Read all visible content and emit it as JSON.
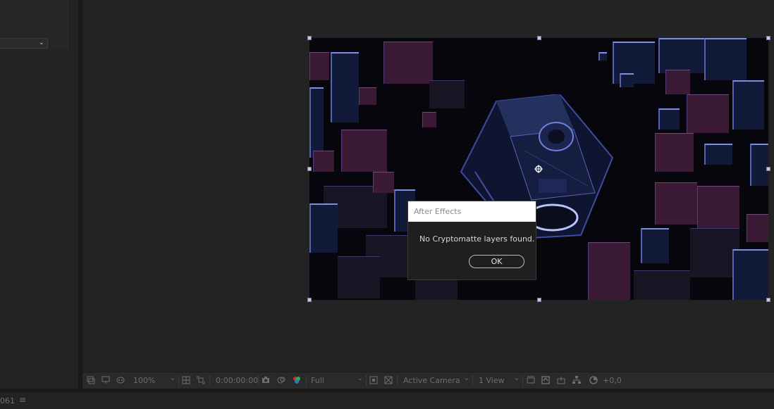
{
  "dialog": {
    "title": "After Effects",
    "message": "No Cryptomatte layers found.",
    "ok_label": "OK"
  },
  "toolbar": {
    "zoom": "100%",
    "timecode": "0:00:00:00",
    "resolution": "Full",
    "camera": "Active Camera",
    "view": "1 View",
    "exposure": "+0,0"
  },
  "status": {
    "value": "061",
    "menu_glyph": "≡"
  },
  "colors": {
    "accent_blue": "#7d8fe0",
    "magenta": "#3a1a34",
    "panel_bg": "#232323"
  }
}
